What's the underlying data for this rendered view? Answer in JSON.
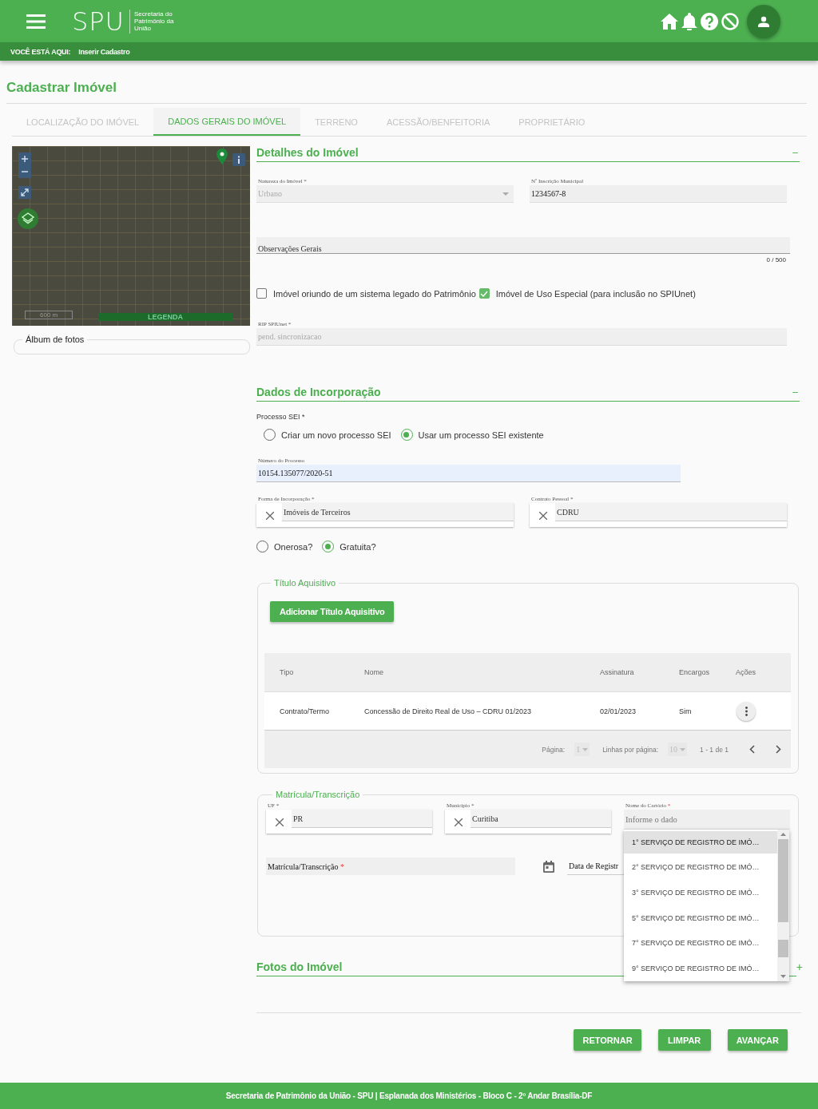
{
  "header": {
    "logo": "SPU",
    "logo_subtitle": "Secretaria do Patrimônio da União"
  },
  "breadcrumb": {
    "label": "VOCÊ ESTÁ AQUI:",
    "current": "Inserir Cadastro"
  },
  "page_title": "Cadastrar Imóvel",
  "tabs": [
    {
      "label": "LOCALIZAÇÃO DO IMÓVEL",
      "selected": false
    },
    {
      "label": "DADOS GERAIS DO IMÓVEL",
      "selected": true
    },
    {
      "label": "TERRENO",
      "selected": false
    },
    {
      "label": "ACESSÃO/BENFEITORIA",
      "selected": false
    },
    {
      "label": "PROPRIETÁRIO",
      "selected": false
    }
  ],
  "map": {
    "scale_label": "600 m",
    "legend": "LEGENDA"
  },
  "album": {
    "title": "Álbum de fotos"
  },
  "detalhes": {
    "title": "Detalhes do Imóvel",
    "toggle": "–",
    "natureza": {
      "label": "Natureza do Imóvel *",
      "value": "Urbano",
      "disabled": true
    },
    "inscricao": {
      "label": "Nº Inscrição Municipal",
      "value": "1234567-8"
    },
    "observacoes": {
      "label": "Observações Gerais",
      "counter": "0 / 500"
    },
    "checkboxes": [
      {
        "label": "Imóvel oriundo de um sistema legado do Patrimônio",
        "checked": false
      },
      {
        "label": "Imóvel de Uso Especial (para inclusão no SPIUnet)",
        "checked": true
      }
    ],
    "rip": {
      "label": "RIP SPIUnet *",
      "placeholder": "pend. sincronizacao"
    }
  },
  "incorporacao": {
    "title": "Dados de Incorporação",
    "toggle": "–",
    "processo_label": "Processo SEI *",
    "processo_options": [
      {
        "label": "Criar um novo processo SEI",
        "selected": false
      },
      {
        "label": "Usar um processo SEI existente",
        "selected": true
      }
    ],
    "numero": {
      "label": "Número do Processo",
      "value": "10154.135077/2020-51"
    },
    "forma": {
      "label": "Forma de Incorporação *",
      "value": "Imóveis de Terceiros"
    },
    "contrato": {
      "label": "Contrato Pessoal *",
      "value": "CDRU"
    },
    "onerosidade": [
      {
        "label": "Onerosa?",
        "selected": false
      },
      {
        "label": "Gratuita?",
        "selected": true
      }
    ]
  },
  "titulo": {
    "legend": "Título Aquisitivo",
    "add_button": "Adicionar Título Aquisitivo",
    "columns": [
      "Tipo",
      "Nome",
      "Assinatura",
      "Encargos",
      "Ações"
    ],
    "rows": [
      {
        "tipo": "Contrato/Termo",
        "nome": "Concessão de Direito Real de Uso – CDRU 01/2023",
        "assinatura": "02/01/2023",
        "encargos": "Sim"
      }
    ],
    "pagination": {
      "page_label": "Página:",
      "page": "1",
      "rows_label": "Linhas por página:",
      "rows": "10",
      "range": "1 - 1 de 1"
    }
  },
  "matricula": {
    "legend": "Matrícula/Transcrição",
    "uf": {
      "label": "UF *",
      "value": "PR"
    },
    "municipio": {
      "label": "Município *",
      "value": "Curitiba"
    },
    "cartorio": {
      "label": "Nome do Cartório",
      "required_mark": "*",
      "placeholder": "Informe o dado",
      "options": [
        {
          "label": "1° SERVIÇO DE REGISTRO DE IMÓ…",
          "selected": true
        },
        {
          "label": "2° SERVIÇO DE REGISTRO DE IMÓ…",
          "selected": false
        },
        {
          "label": "3° SERVIÇO DE REGISTRO DE IMÓ…",
          "selected": false
        },
        {
          "label": "5° SERVIÇO DE REGISTRO DE IMÓ…",
          "selected": false
        },
        {
          "label": "7° SERVIÇO DE REGISTRO DE IMÓ…",
          "selected": false
        },
        {
          "label": "9° SERVIÇO DE REGISTRO DE IMÓ…",
          "selected": false
        }
      ]
    },
    "matricula_field": {
      "label": "Matrícula/Transcrição",
      "required_mark": "*"
    },
    "data_registro": {
      "label": "Data de Registr"
    }
  },
  "fotos": {
    "title": "Fotos do Imóvel",
    "toggle": "+"
  },
  "buttons": [
    "RETORNAR",
    "LIMPAR",
    "AVANÇAR"
  ],
  "footer": "Secretaria de Patrimônio da União - SPU | Esplanada dos Ministérios - Bloco C - 2º Andar Brasília-DF"
}
